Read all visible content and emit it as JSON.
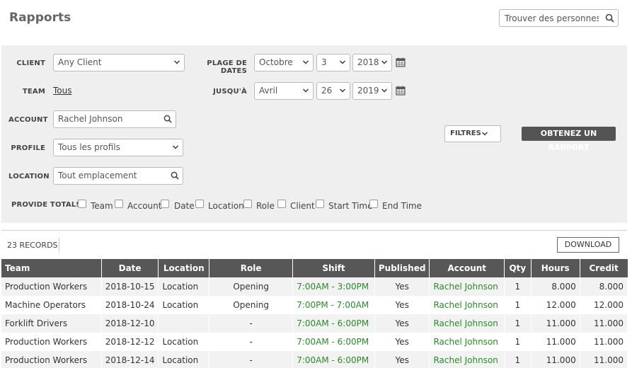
{
  "header": {
    "title": "Rapports",
    "search_placeholder": "Trouver des personnes.."
  },
  "filters": {
    "client_label": "CLIENT",
    "client_value": "Any Client",
    "date_range_label": "PLAGE DE DATES",
    "from_month": "Octobre",
    "from_day": "3",
    "from_year": "2018",
    "team_label": "TEAM",
    "team_value": "Tous",
    "until_label": "JUSQU'À",
    "to_month": "Avril",
    "to_day": "26",
    "to_year": "2019",
    "account_label": "ACCOUNT",
    "account_value": "Rachel Johnson",
    "profile_label": "PROFILE",
    "profile_value": "Tous les profils",
    "location_label": "LOCATION",
    "location_placeholder": "Tout emplacement",
    "totals_label": "PROVIDE TOTALS",
    "totals_options": [
      "Team",
      "Account",
      "Date",
      "Location",
      "Role",
      "Client",
      "Start Time",
      "End Time"
    ],
    "filters_button": "FILTRES",
    "report_button": "OBTENEZ UN RAPPORT"
  },
  "records": {
    "count_label": "23 RECORDS",
    "download_button": "DOWNLOAD"
  },
  "table": {
    "columns": [
      "Team",
      "Date",
      "Location",
      "Role",
      "Shift",
      "Published",
      "Account",
      "Qty",
      "Hours",
      "Credit"
    ],
    "rows": [
      [
        "Production Workers",
        "2018-10-15",
        "Location",
        "Opening",
        "7:00AM - 3:00PM",
        "Yes",
        "Rachel Johnson",
        "1",
        "8.000",
        "8.000"
      ],
      [
        "Machine Operators",
        "2018-10-24",
        "Location",
        "Opening",
        "7:00PM - 7:00AM",
        "Yes",
        "Rachel Johnson",
        "1",
        "12.000",
        "12.000"
      ],
      [
        "Forklift Drivers",
        "2018-12-10",
        "",
        "-",
        "7:00AM - 6:00PM",
        "Yes",
        "Rachel Johnson",
        "1",
        "11.000",
        "11.000"
      ],
      [
        "Production Workers",
        "2018-12-12",
        "Location",
        "-",
        "7:00AM - 6:00PM",
        "Yes",
        "Rachel Johnson",
        "1",
        "11.000",
        "11.000"
      ],
      [
        "Production Workers",
        "2018-12-14",
        "Location",
        "-",
        "7:00AM - 6:00PM",
        "Yes",
        "Rachel Johnson",
        "1",
        "11.000",
        "11.000"
      ]
    ]
  },
  "colors": {
    "header_bg": "#575757",
    "link_green": "#2a8a2a",
    "panel_bg": "#efefef"
  }
}
